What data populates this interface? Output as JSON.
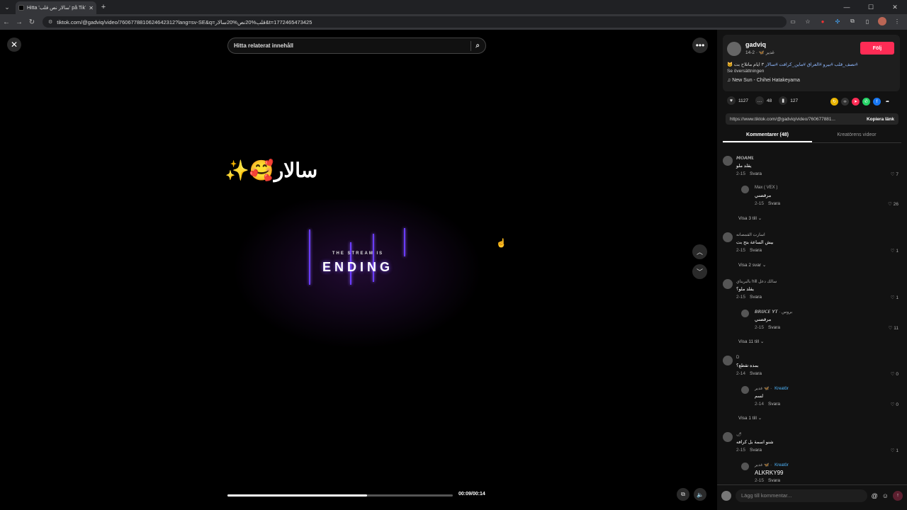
{
  "browser": {
    "tab_title": "Hitta 'سالار نص قلب' på TikTok",
    "url": "tiktok.com/@gadviq/video/7606778810624642312?lang=sv-SE&q=قلب%20نص%20سالار&t=1772465473425",
    "tab_close": "✕",
    "new_tab": "+",
    "win_min": "—",
    "win_max": "☐",
    "win_close": "✕"
  },
  "video": {
    "search_placeholder": "Hitta relaterat innehåll",
    "overlay_text": "✨🥰سالار",
    "stream_small": "THE STREAM IS",
    "stream_big": "ENDING",
    "time": "00:09/00:14",
    "progress": 0.62
  },
  "creator": {
    "username": "gadviq",
    "subline": "غدير 🦋 · 2-14",
    "follow_label": "Följ",
    "description_tags": "#نصف_قلب #بيرو #العراق #ماين_كرافت #سالار",
    "description_text": "٣ ايام ماتلاح بت 🐱",
    "translate_label": "Se översättningen",
    "music": "♫  New Sun - Chihei Hatakeyama"
  },
  "stats": {
    "likes": "1127",
    "comments": "48",
    "saves": "127"
  },
  "link": {
    "url": "https://www.tiktok.com/@gadviq/video/760677881...",
    "copy_label": "Kopiera länk"
  },
  "tabs": {
    "comments": "Kommentarer (48)",
    "creator_videos": "Kreatörens videor"
  },
  "comments": [
    {
      "name": "𝙈𝙊𝘼𝙈𝙇",
      "text": "يقلد ملو",
      "date": "2-15",
      "reply": "Svara",
      "likes": "♡ 7"
    },
    {
      "name": "Max ( VEX )",
      "text": "مرقضني",
      "date": "2-15",
      "reply": "Svara",
      "likes": "♡ 26"
    },
    {
      "name": "اسارت القمصانه",
      "text": "بيش الساعة بتح بت",
      "date": "2-15",
      "reply": "Svara",
      "likes": "♡ 1"
    },
    {
      "name": "بالبريناي hill سالك دعل",
      "text": "يقلد ملو؟",
      "date": "2-15",
      "reply": "Svara",
      "likes": "♡ 1"
    },
    {
      "name": "𝘽𝙍𝙐𝘾𝙀 𝙔𝙏 · بروس",
      "text": "مرقضني",
      "date": "2-15",
      "reply": "Svara",
      "likes": "♡ 11"
    },
    {
      "name": "D",
      "text": "بمده تقطع؟",
      "date": "2-14",
      "reply": "Svara",
      "likes": "♡ 0"
    },
    {
      "name": "غدير 🦋 ·",
      "creator": "Kreatör",
      "text": "لسم",
      "date": "2-14",
      "reply": "Svara",
      "likes": "♡ 0"
    },
    {
      "name": "🌶",
      "text": "شنو اسمة بل كرافه",
      "date": "2-15",
      "reply": "Svara",
      "likes": "♡ 1"
    },
    {
      "name": "غدير 🦋 ·",
      "creator": "Kreatör",
      "text": "ALKRKY99",
      "date": "2-15",
      "reply": "Svara",
      "likes": ""
    }
  ],
  "more_replies": [
    "Visa 3 till ⌄",
    "Visa 2 svar ⌄",
    "Visa 11 till ⌄",
    "Visa 1 till ⌄"
  ],
  "compose_placeholder": "Lägg till kommentar...",
  "colors": {
    "accent": "#fe2c55",
    "creator_tag": "#4fb7ff",
    "panel_bg": "#121212"
  }
}
